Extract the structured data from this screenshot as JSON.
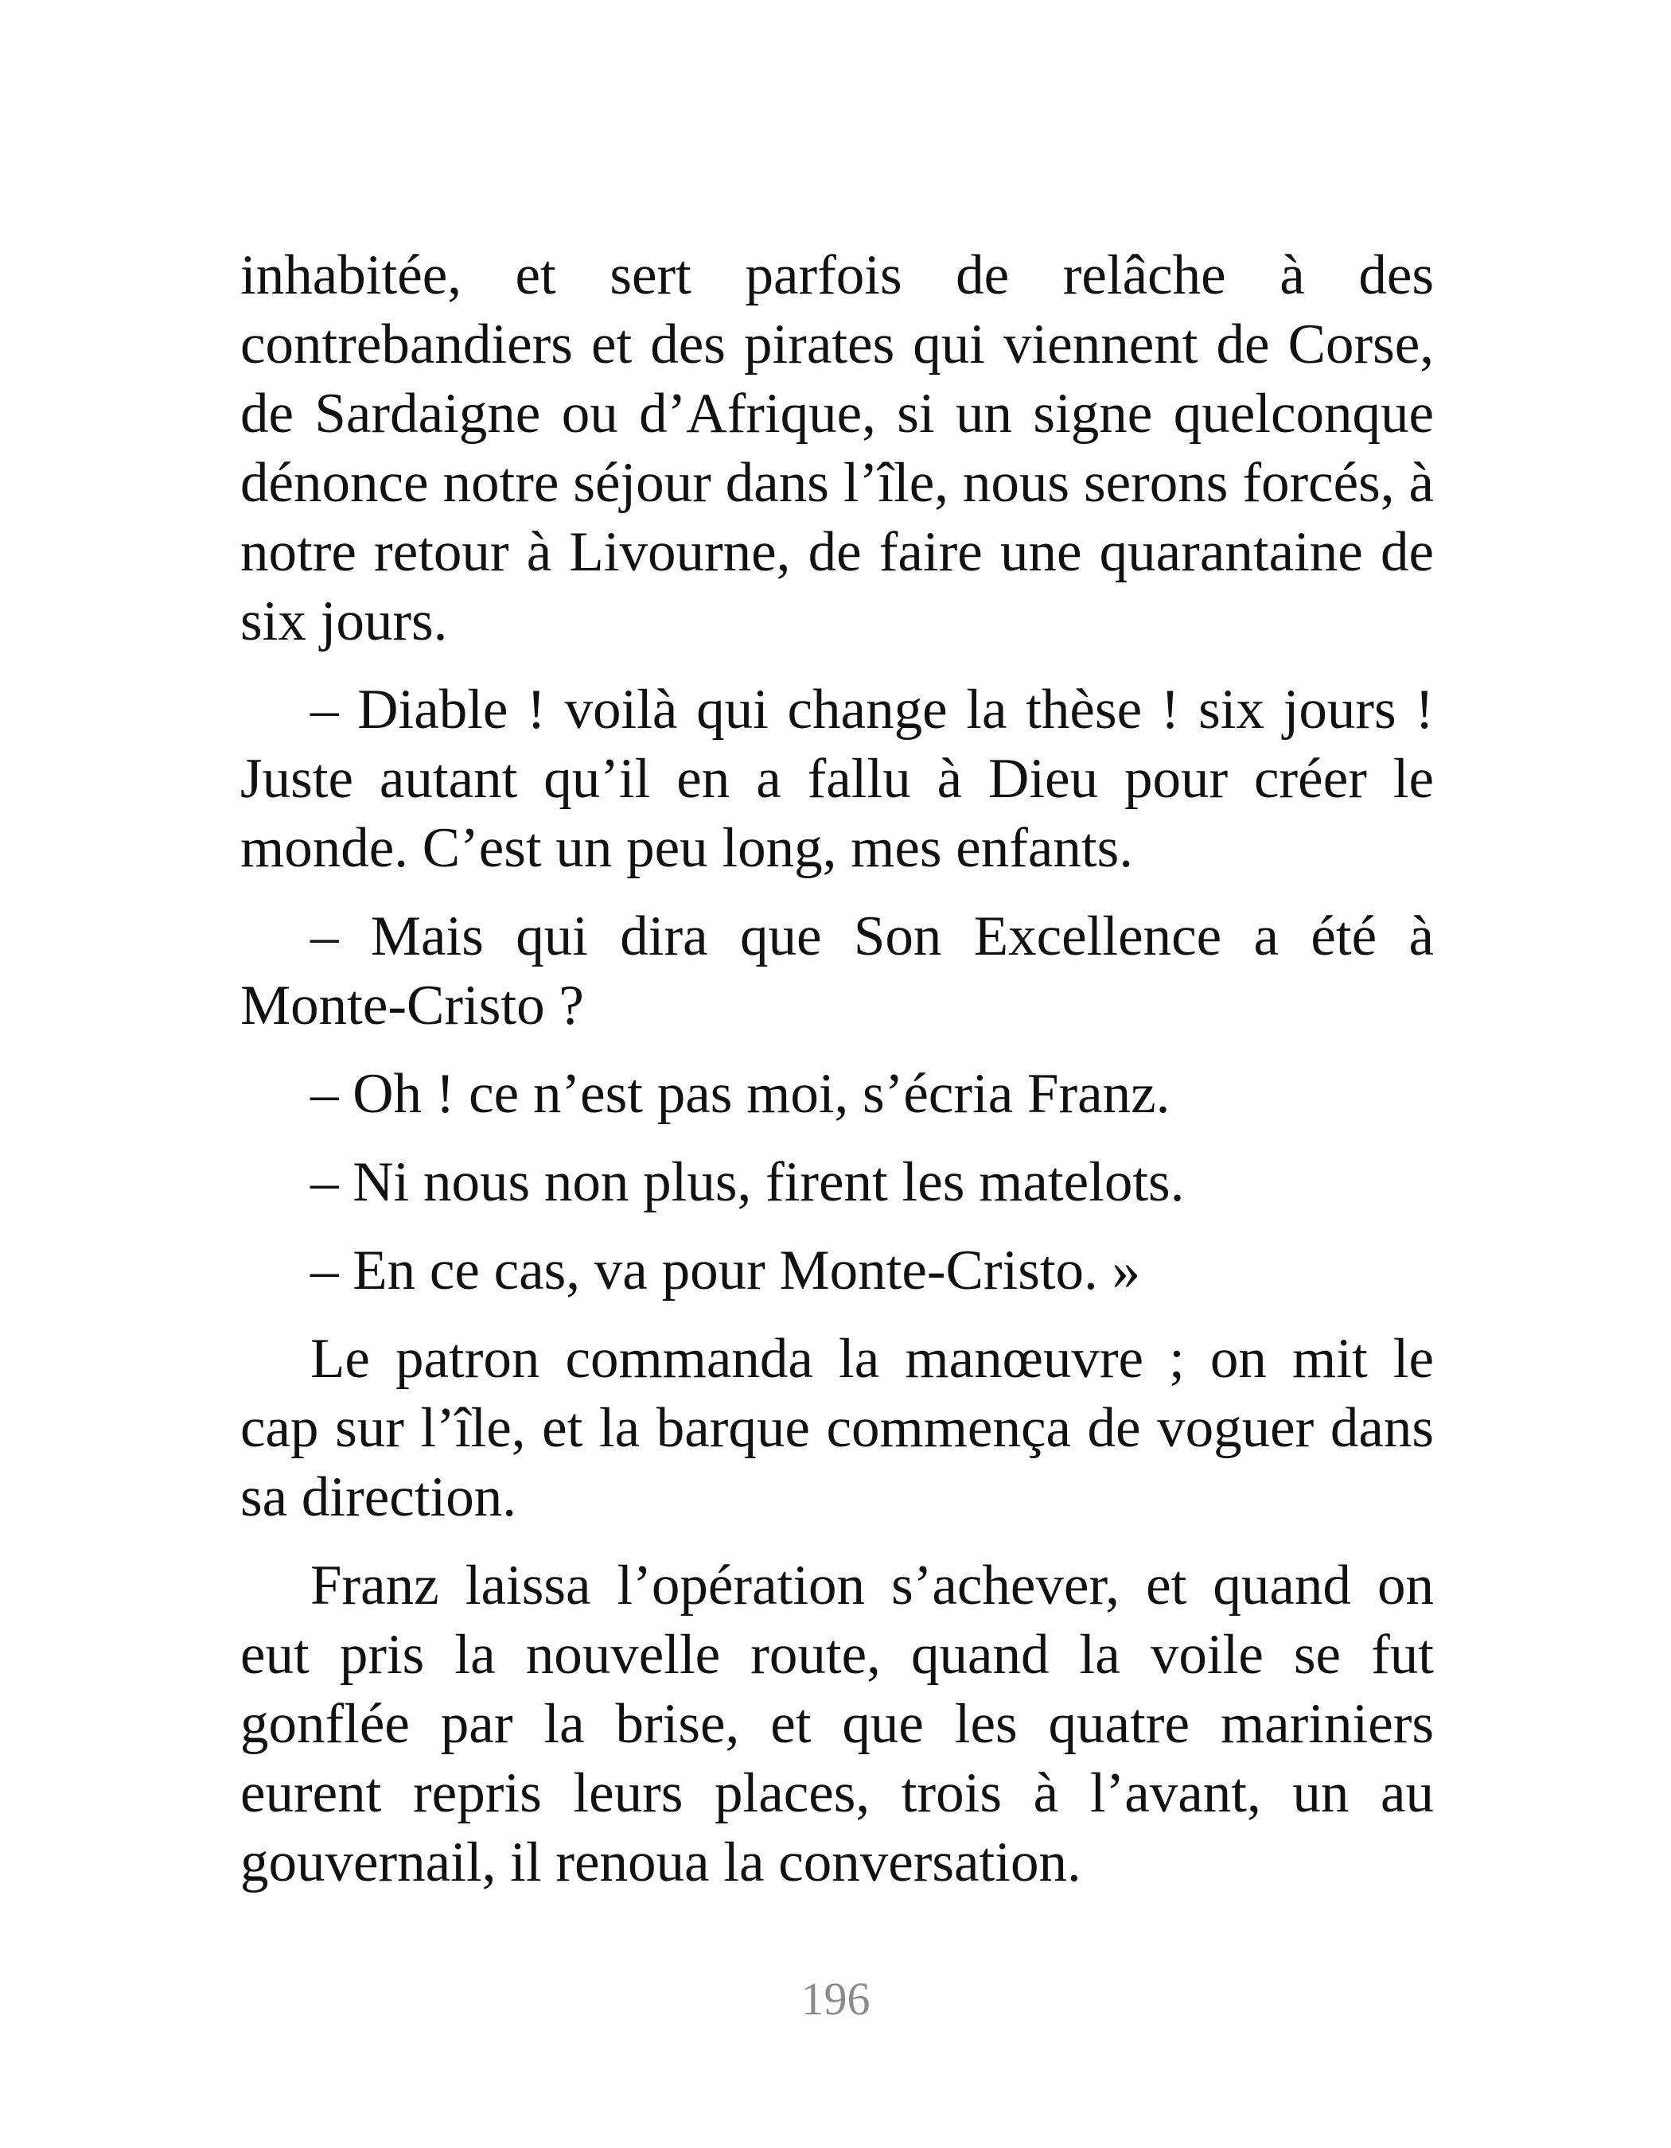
{
  "paragraphs": [
    "inhabitée, et sert parfois de relâche à des contrebandiers et des pirates qui viennent de Corse, de Sardaigne ou d’Afrique, si un signe quelconque dénonce notre séjour dans l’île, nous serons forcés, à notre retour à Livourne, de faire une quarantaine de six jours.",
    "– Diable ! voilà qui change la thèse ! six jours ! Juste autant qu’il en a fallu à Dieu pour créer le monde. C’est un peu long, mes enfants.",
    "– Mais qui dira que Son Excellence a été à Monte-Cristo ?",
    "– Oh ! ce n’est pas moi, s’écria Franz.",
    "– Ni nous non plus, firent les matelots.",
    "– En ce cas, va pour Monte-Cristo. »",
    "Le patron commanda la manœuvre ; on mit le cap sur l’île, et la barque commença de voguer dans sa direction.",
    "Franz laissa l’opération s’achever, et quand on eut pris la nouvelle route, quand la voile se fut gonflée par la brise, et que les quatre mariniers eurent repris leurs places, trois à l’avant, un au gouvernail, il renoua la conversation."
  ],
  "page_number": "196"
}
